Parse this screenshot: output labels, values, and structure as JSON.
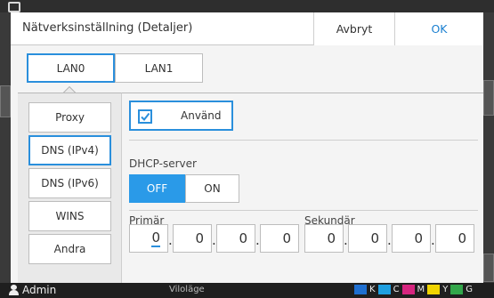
{
  "dialog": {
    "title": "Nätverksinställning (Detaljer)",
    "cancel_label": "Avbryt",
    "ok_label": "OK"
  },
  "lan_tabs": [
    {
      "label": "LAN0",
      "active": true
    },
    {
      "label": "LAN1",
      "active": false
    }
  ],
  "sidebar": {
    "items": [
      {
        "label": "Proxy",
        "active": false
      },
      {
        "label": "DNS (IPv4)",
        "active": true
      },
      {
        "label": "DNS (IPv6)",
        "active": false
      },
      {
        "label": "WINS",
        "active": false
      },
      {
        "label": "Andra",
        "active": false
      }
    ]
  },
  "settings": {
    "use_label": "Använd",
    "use_checked": true,
    "dhcp_label": "DHCP-server",
    "dhcp_options": [
      "OFF",
      "ON"
    ],
    "dhcp_selected": "OFF",
    "primary_label": "Primär",
    "primary_octets": [
      "0",
      "0",
      "0",
      "0"
    ],
    "secondary_label": "Sekundär",
    "secondary_octets": [
      "0",
      "0",
      "0",
      "0"
    ]
  },
  "status": {
    "user": "Admin",
    "mode": "Viloläge",
    "toner": [
      "K",
      "C",
      "M",
      "Y",
      "G"
    ]
  },
  "colors": {
    "accent": "#2a8fdc",
    "toner_k": "#1a1a1a",
    "toner_c": "#1e9fe0",
    "toner_m": "#d6257f",
    "toner_y": "#f0d400",
    "toner_g": "#33a64a"
  }
}
